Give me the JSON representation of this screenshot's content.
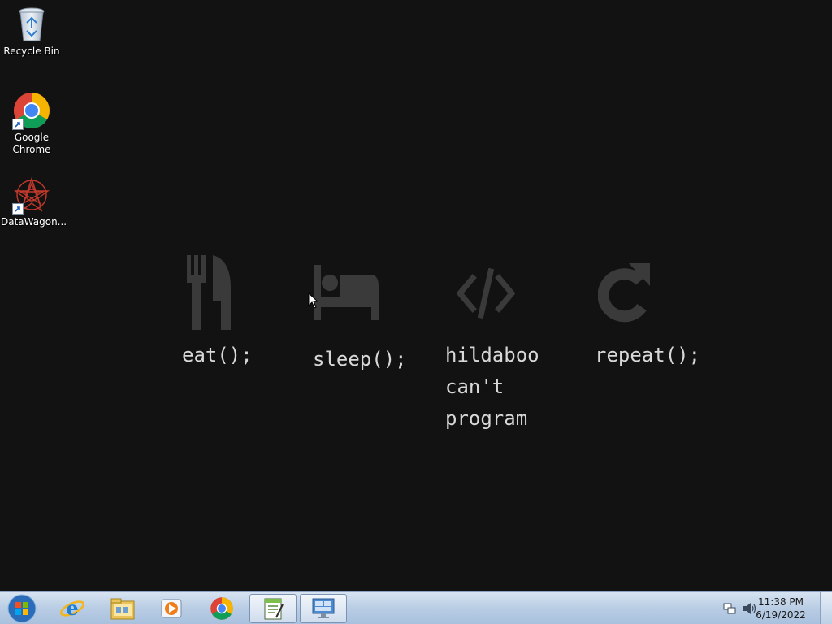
{
  "desktop": {
    "icons": [
      {
        "label": "Recycle Bin",
        "icon": "recycle-bin-icon"
      },
      {
        "label": "Google\nChrome",
        "icon": "chrome-icon"
      },
      {
        "label": "DataWagon...",
        "icon": "datawagon-icon"
      }
    ]
  },
  "wallpaper": {
    "items": [
      {
        "label": "eat();",
        "icon": "fork-knife-icon"
      },
      {
        "label": "sleep();",
        "icon": "bed-icon"
      },
      {
        "label": "hildaboo\ncan't\nprogram",
        "icon": "code-icon"
      },
      {
        "label": "repeat();",
        "icon": "redo-icon"
      }
    ]
  },
  "taskbar": {
    "start_icon": "windows-start-icon",
    "pinned": [
      "internet-explorer-icon",
      "file-explorer-icon",
      "media-player-icon",
      "chrome-icon",
      "notepad-icon",
      "remote-desktop-icon"
    ],
    "tray_icons": [
      "network-icon",
      "volume-icon"
    ],
    "clock_time": "11:38 PM",
    "clock_date": "6/19/2022"
  },
  "colors": {
    "desktop_bg": "#121212",
    "wallpaper_icon": "#3a3a3a",
    "wallpaper_text": "#d8d8d8",
    "taskbar": "#b9cde4"
  }
}
